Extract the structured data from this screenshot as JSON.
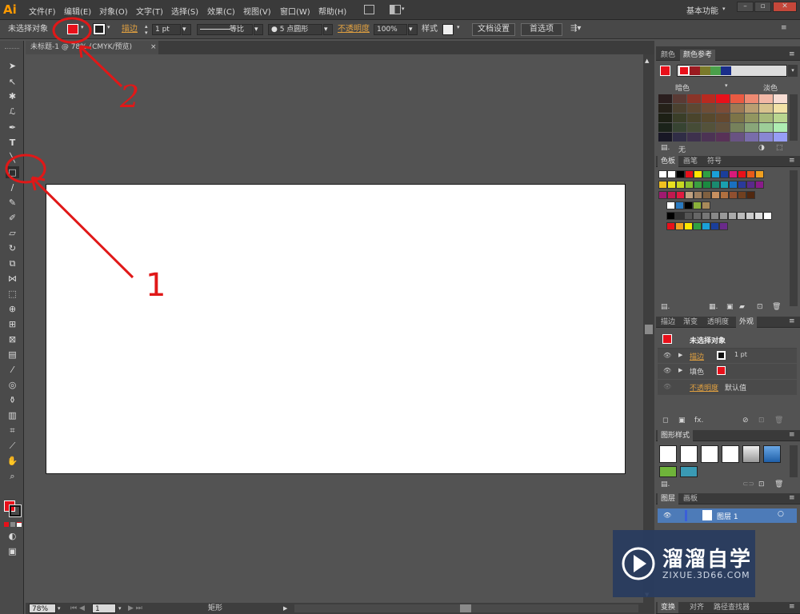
{
  "app": {
    "logo": "Ai",
    "workspace": "基本功能"
  },
  "menu": [
    "文件(F)",
    "编辑(E)",
    "对象(O)",
    "文字(T)",
    "选择(S)",
    "效果(C)",
    "视图(V)",
    "窗口(W)",
    "帮助(H)"
  ],
  "control": {
    "selection": "未选择对象",
    "stroke_label": "描边",
    "stroke_weight": "1 pt",
    "line_style": "等比",
    "brush": "● 5 点圆形",
    "opacity_label": "不透明度",
    "opacity": "100%",
    "style_label": "样式",
    "doc_setup": "文档设置",
    "prefs": "首选项"
  },
  "document": {
    "tab": "未标题-1 @ 78% (CMYK/预览)",
    "zoom": "78%",
    "page": "1",
    "tool_status": "矩形"
  },
  "panels": {
    "color_tabs": [
      "颜色",
      "颜色参考"
    ],
    "color_guide": {
      "darker": "暗色",
      "lighter": "淡色",
      "none": "无"
    },
    "swatch_tabs": [
      "色板",
      "画笔",
      "符号"
    ],
    "appearance_tabs": [
      "描边",
      "渐变",
      "透明度",
      "外观"
    ],
    "appearance": {
      "title": "未选择对象",
      "stroke": "描边",
      "stroke_value": "1 pt",
      "fill": "填色",
      "opacity": "不透明度",
      "opacity_value": "默认值"
    },
    "graphic_styles": "图形样式",
    "layers_tabs": [
      "图层",
      "画板"
    ],
    "layer_name": "图层 1",
    "bottom_tabs": [
      "变换",
      "对齐",
      "路径查找器"
    ]
  },
  "annotations": {
    "label_1": "1",
    "label_2": "2"
  },
  "watermark": {
    "brand": "溜溜自学",
    "url": "ZIXUE.3D66.COM"
  },
  "colors": {
    "accent": "#e8101a",
    "annotation": "#e01818",
    "ai_orange": "#ff9a00"
  }
}
